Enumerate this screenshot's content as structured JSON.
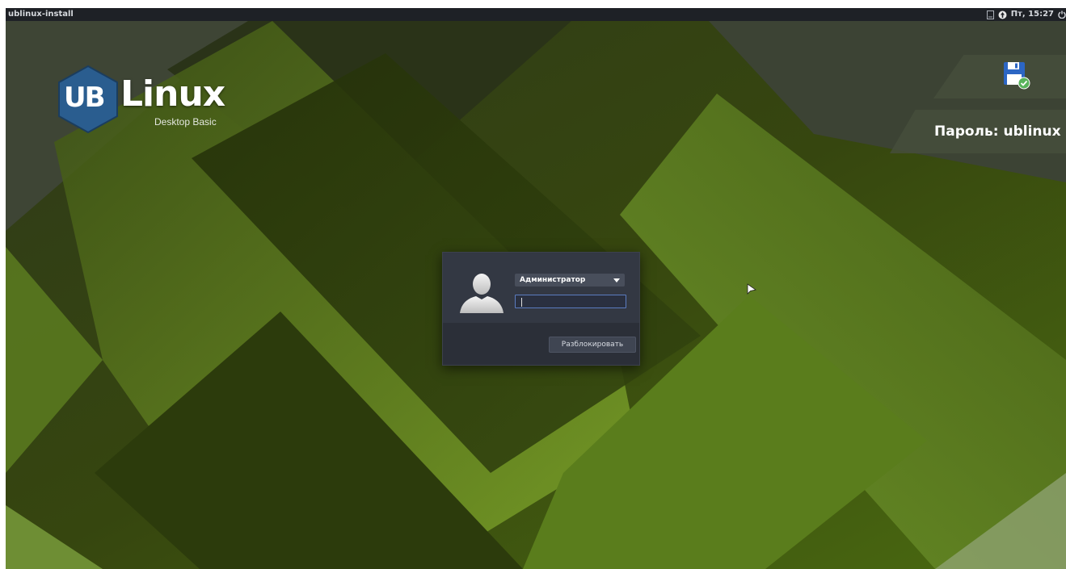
{
  "topbar": {
    "hostname": "ublinux-install",
    "clock": "Пт, 15:27",
    "icons": [
      "notes-icon",
      "network-icon",
      "power-icon"
    ]
  },
  "branding": {
    "logo_mark": "UB",
    "logo_word": "Linux",
    "edition": "Desktop Basic"
  },
  "overlay": {
    "save_icon": "floppy-disk-check-icon",
    "password_hint": "Пароль: ublinux"
  },
  "login": {
    "avatar_icon": "user-silhouette-icon",
    "user_selected": "Администратор",
    "password_value": "",
    "unlock_label": "Разблокировать"
  },
  "colors": {
    "accent_field_border": "#5b7cc0",
    "topbar_bg": "#1e2126",
    "dialog_bg": "#2b2f38",
    "logo_hex": "#2a5d8f"
  }
}
